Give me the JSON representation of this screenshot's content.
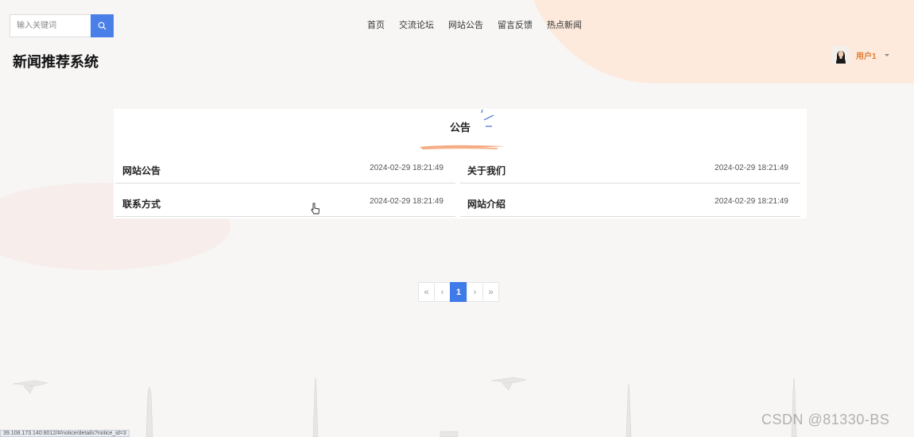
{
  "search": {
    "placeholder": "输入关键词"
  },
  "nav": [
    "首页",
    "交流论坛",
    "网站公告",
    "留言反馈",
    "热点新闻"
  ],
  "site_title": "新闻推荐系统",
  "user": {
    "name": "用户1"
  },
  "panel": {
    "title": "公告",
    "notices": [
      {
        "title": "网站公告",
        "time": "2024-02-29 18:21:49"
      },
      {
        "title": "关于我们",
        "time": "2024-02-29 18:21:49"
      },
      {
        "title": "联系方式",
        "time": "2024-02-29 18:21:49"
      },
      {
        "title": "网站介绍",
        "time": "2024-02-29 18:21:49"
      }
    ]
  },
  "pagination": {
    "first": "«",
    "prev": "‹",
    "current": "1",
    "next": "›",
    "last": "»"
  },
  "status_url": "39.108.173.140:8012/#/notice/details?notice_id=3",
  "watermark": "CSDN @81330-BS",
  "colors": {
    "accent": "#3f7be8",
    "user_name": "#e07b33",
    "brush": "#f29a6a"
  }
}
